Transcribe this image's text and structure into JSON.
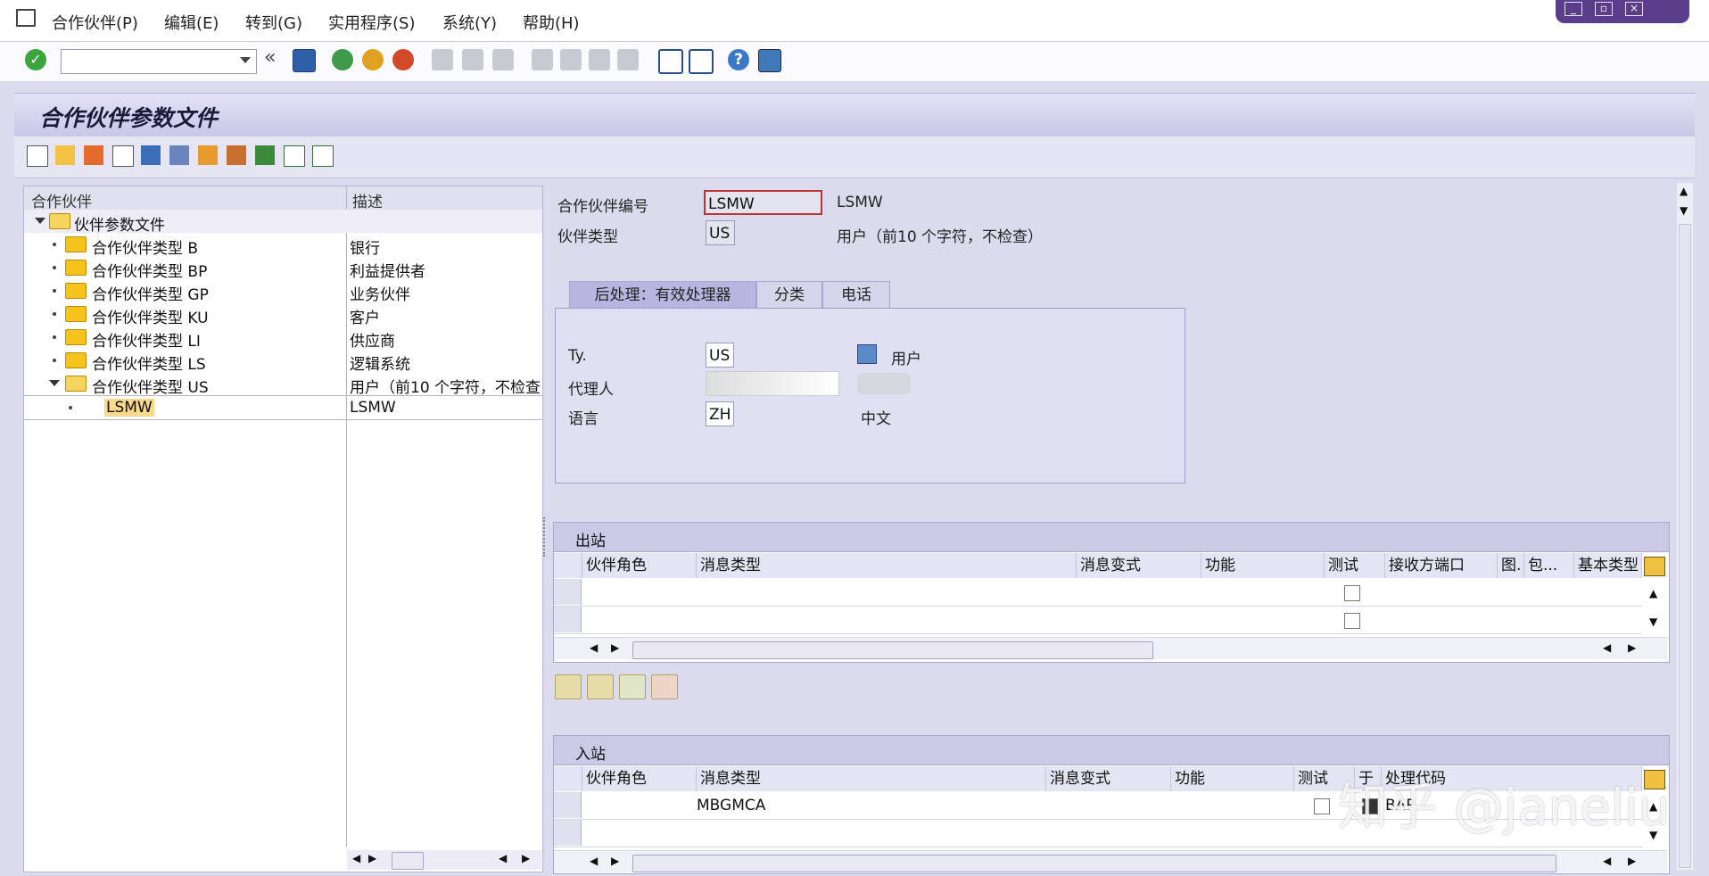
{
  "menu": [
    "合作伙伴(P)",
    "编辑(E)",
    "转到(G)",
    "实用程序(S)",
    "系统(Y)",
    "帮助(H)"
  ],
  "page_title": "合作伙伴参数文件",
  "tree": {
    "col_partner": "合作伙伴",
    "col_desc": "描述",
    "root": "伙伴参数文件",
    "items": [
      {
        "label": "合作伙伴类型 B",
        "desc": "银行"
      },
      {
        "label": "合作伙伴类型 BP",
        "desc": "利益提供者"
      },
      {
        "label": "合作伙伴类型 GP",
        "desc": "业务伙伴"
      },
      {
        "label": "合作伙伴类型 KU",
        "desc": "客户"
      },
      {
        "label": "合作伙伴类型 LI",
        "desc": "供应商"
      },
      {
        "label": "合作伙伴类型 LS",
        "desc": "逻辑系统"
      },
      {
        "label": "合作伙伴类型 US",
        "desc": "用户（前10 个字符，不检查）"
      }
    ],
    "child": {
      "label": "LSMW",
      "desc": "LSMW"
    }
  },
  "header_form": {
    "partner_no_label": "合作伙伴编号",
    "partner_no": "LSMW",
    "partner_no_text": "LSMW",
    "partner_type_label": "伙伴类型",
    "partner_type": "US",
    "partner_type_text": "用户（前10 个字符，不检查）"
  },
  "tabs": [
    "后处理：有效处理器",
    "分类",
    "电话"
  ],
  "tab_panel": {
    "ty_label": "Ty.",
    "ty_value": "US",
    "ty_text": "用户",
    "agent_label": "代理人",
    "language_label": "语言",
    "language_value": "ZH",
    "language_text": "中文"
  },
  "outbound": {
    "title": "出站",
    "columns": [
      "伙伴角色",
      "消息类型",
      "消息变式",
      "功能",
      "测试",
      "接收方端口",
      "图.",
      "包...",
      "基本类型"
    ]
  },
  "inbound": {
    "title": "入站",
    "columns": [
      "伙伴角色",
      "消息类型",
      "消息变式",
      "功能",
      "测试",
      "于",
      "处理代码"
    ],
    "rows": [
      {
        "message_type": "MBGMCA",
        "process_code": "BAP"
      }
    ]
  },
  "watermark": "知乎 @janeliu"
}
